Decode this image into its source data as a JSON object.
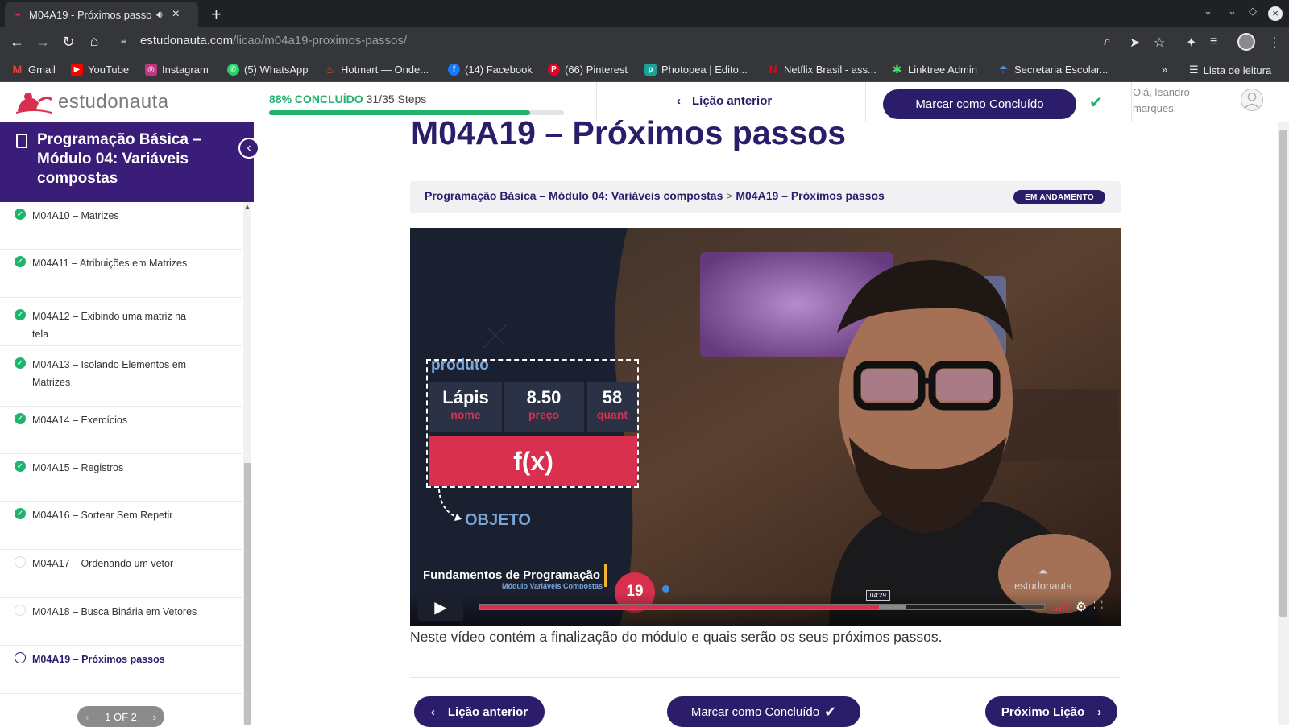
{
  "browser": {
    "tab_title": "M04A19 - Próximos passo",
    "url_host": "estudonauta.com",
    "url_path": "/licao/m04a19-proximos-passos/",
    "bookmarks": [
      {
        "label": "Gmail",
        "icon": "gmail-icon",
        "color": "#ea4335"
      },
      {
        "label": "YouTube",
        "icon": "youtube-icon",
        "color": "#ff0000"
      },
      {
        "label": "Instagram",
        "icon": "instagram-icon",
        "color": "#c13584"
      },
      {
        "label": "(5) WhatsApp",
        "icon": "whatsapp-icon",
        "color": "#25d366"
      },
      {
        "label": "Hotmart — Onde...",
        "icon": "hotmart-icon",
        "color": "#f04e23"
      },
      {
        "label": "(14) Facebook",
        "icon": "facebook-icon",
        "color": "#1877f2"
      },
      {
        "label": "(66) Pinterest",
        "icon": "pinterest-icon",
        "color": "#e60023"
      },
      {
        "label": "Photopea | Edito...",
        "icon": "photopea-icon",
        "color": "#18a497"
      },
      {
        "label": "Netflix Brasil - ass...",
        "icon": "netflix-icon",
        "color": "#e50914"
      },
      {
        "label": "Linktree Admin",
        "icon": "linktree-icon",
        "color": "#43e660"
      },
      {
        "label": "Secretaria Escolar...",
        "icon": "secretaria-icon",
        "color": "#4a90e2"
      }
    ],
    "reading_list": "Lista de leitura"
  },
  "header": {
    "logo_text": "estudonauta",
    "progress_percent_label": "88% CONCLUÍDO",
    "progress_steps": "31/35 Steps",
    "progress_fraction": 0.886,
    "prev_label": "Lição anterior",
    "mark_complete": "Marcar como Concluído",
    "greeting": "Olá, leandro-marques!"
  },
  "sidebar": {
    "course_title": "Programação Básica – Módulo 04: Variáveis compostas",
    "items": [
      {
        "label": "M04A10 – Matrizes",
        "status": "done"
      },
      {
        "label": "M04A11 – Atribuições em Matrizes",
        "status": "done"
      },
      {
        "label": "M04A12 – Exibindo uma matriz na tela",
        "status": "done"
      },
      {
        "label": "M04A13 – Isolando Elementos em Matrizes",
        "status": "done"
      },
      {
        "label": "M04A14 – Exercícios",
        "status": "done"
      },
      {
        "label": "M04A15 – Registros",
        "status": "done"
      },
      {
        "label": "M04A16 – Sortear Sem Repetir",
        "status": "done"
      },
      {
        "label": "M04A17 – Ordenando um vetor",
        "status": "todo"
      },
      {
        "label": "M04A18 – Busca Binária em Vetores",
        "status": "todo"
      },
      {
        "label": "M04A19 – Próximos passos",
        "status": "current"
      }
    ],
    "pager": "1 OF 2"
  },
  "main": {
    "title": "M04A19 – Próximos passos",
    "breadcrumb_course": "Programação Básica – Módulo 04: Variáveis compostas",
    "breadcrumb_sep": ">",
    "breadcrumb_lesson": "M04A19 – Próximos passos",
    "status_badge": "EM ANDAMENTO",
    "description": "Neste vídeo contém a finalização do módulo e quais serão os seus próximos passos.",
    "prev_button": "Lição anterior",
    "mark_button": "Marcar como Concluído",
    "next_button": "Próximo Lição"
  },
  "video": {
    "box_title": "produto",
    "cells": [
      {
        "value": "Lápis",
        "label": "nome"
      },
      {
        "value": "8.50",
        "label": "preço"
      },
      {
        "value": "58",
        "label": "quant"
      }
    ],
    "function_label": "f(x)",
    "object_label": "OBJETO",
    "series_title": "Fundamentos de Programação",
    "series_subtitle": "Módulo Variáveis Compostas",
    "episode": "19",
    "watermark": "estudonauta",
    "time_tooltip": "04:29",
    "played_fraction": 0.707,
    "buffered_fraction": 0.755
  },
  "colors": {
    "brand_purple": "#2b1d6a",
    "sidebar_purple": "#3a1d78",
    "success_green": "#1fb36b",
    "video_red": "#d9304f"
  }
}
